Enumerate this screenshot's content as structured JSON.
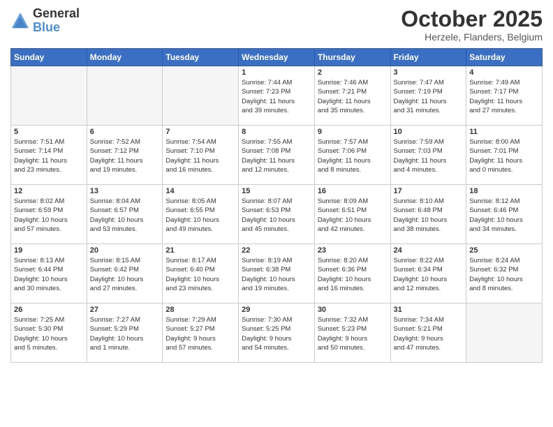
{
  "header": {
    "logo": {
      "line1": "General",
      "line2": "Blue"
    },
    "month": "October 2025",
    "location": "Herzele, Flanders, Belgium"
  },
  "weekdays": [
    "Sunday",
    "Monday",
    "Tuesday",
    "Wednesday",
    "Thursday",
    "Friday",
    "Saturday"
  ],
  "weeks": [
    [
      {
        "day": "",
        "info": "",
        "empty": true
      },
      {
        "day": "",
        "info": "",
        "empty": true
      },
      {
        "day": "",
        "info": "",
        "empty": true
      },
      {
        "day": "1",
        "info": "Sunrise: 7:44 AM\nSunset: 7:23 PM\nDaylight: 11 hours\nand 39 minutes."
      },
      {
        "day": "2",
        "info": "Sunrise: 7:46 AM\nSunset: 7:21 PM\nDaylight: 11 hours\nand 35 minutes."
      },
      {
        "day": "3",
        "info": "Sunrise: 7:47 AM\nSunset: 7:19 PM\nDaylight: 11 hours\nand 31 minutes."
      },
      {
        "day": "4",
        "info": "Sunrise: 7:49 AM\nSunset: 7:17 PM\nDaylight: 11 hours\nand 27 minutes."
      }
    ],
    [
      {
        "day": "5",
        "info": "Sunrise: 7:51 AM\nSunset: 7:14 PM\nDaylight: 11 hours\nand 23 minutes."
      },
      {
        "day": "6",
        "info": "Sunrise: 7:52 AM\nSunset: 7:12 PM\nDaylight: 11 hours\nand 19 minutes."
      },
      {
        "day": "7",
        "info": "Sunrise: 7:54 AM\nSunset: 7:10 PM\nDaylight: 11 hours\nand 16 minutes."
      },
      {
        "day": "8",
        "info": "Sunrise: 7:55 AM\nSunset: 7:08 PM\nDaylight: 11 hours\nand 12 minutes."
      },
      {
        "day": "9",
        "info": "Sunrise: 7:57 AM\nSunset: 7:06 PM\nDaylight: 11 hours\nand 8 minutes."
      },
      {
        "day": "10",
        "info": "Sunrise: 7:59 AM\nSunset: 7:03 PM\nDaylight: 11 hours\nand 4 minutes."
      },
      {
        "day": "11",
        "info": "Sunrise: 8:00 AM\nSunset: 7:01 PM\nDaylight: 11 hours\nand 0 minutes."
      }
    ],
    [
      {
        "day": "12",
        "info": "Sunrise: 8:02 AM\nSunset: 6:59 PM\nDaylight: 10 hours\nand 57 minutes."
      },
      {
        "day": "13",
        "info": "Sunrise: 8:04 AM\nSunset: 6:57 PM\nDaylight: 10 hours\nand 53 minutes."
      },
      {
        "day": "14",
        "info": "Sunrise: 8:05 AM\nSunset: 6:55 PM\nDaylight: 10 hours\nand 49 minutes."
      },
      {
        "day": "15",
        "info": "Sunrise: 8:07 AM\nSunset: 6:53 PM\nDaylight: 10 hours\nand 45 minutes."
      },
      {
        "day": "16",
        "info": "Sunrise: 8:09 AM\nSunset: 6:51 PM\nDaylight: 10 hours\nand 42 minutes."
      },
      {
        "day": "17",
        "info": "Sunrise: 8:10 AM\nSunset: 6:48 PM\nDaylight: 10 hours\nand 38 minutes."
      },
      {
        "day": "18",
        "info": "Sunrise: 8:12 AM\nSunset: 6:46 PM\nDaylight: 10 hours\nand 34 minutes."
      }
    ],
    [
      {
        "day": "19",
        "info": "Sunrise: 8:13 AM\nSunset: 6:44 PM\nDaylight: 10 hours\nand 30 minutes."
      },
      {
        "day": "20",
        "info": "Sunrise: 8:15 AM\nSunset: 6:42 PM\nDaylight: 10 hours\nand 27 minutes."
      },
      {
        "day": "21",
        "info": "Sunrise: 8:17 AM\nSunset: 6:40 PM\nDaylight: 10 hours\nand 23 minutes."
      },
      {
        "day": "22",
        "info": "Sunrise: 8:19 AM\nSunset: 6:38 PM\nDaylight: 10 hours\nand 19 minutes."
      },
      {
        "day": "23",
        "info": "Sunrise: 8:20 AM\nSunset: 6:36 PM\nDaylight: 10 hours\nand 16 minutes."
      },
      {
        "day": "24",
        "info": "Sunrise: 8:22 AM\nSunset: 6:34 PM\nDaylight: 10 hours\nand 12 minutes."
      },
      {
        "day": "25",
        "info": "Sunrise: 8:24 AM\nSunset: 6:32 PM\nDaylight: 10 hours\nand 8 minutes."
      }
    ],
    [
      {
        "day": "26",
        "info": "Sunrise: 7:25 AM\nSunset: 5:30 PM\nDaylight: 10 hours\nand 5 minutes."
      },
      {
        "day": "27",
        "info": "Sunrise: 7:27 AM\nSunset: 5:29 PM\nDaylight: 10 hours\nand 1 minute."
      },
      {
        "day": "28",
        "info": "Sunrise: 7:29 AM\nSunset: 5:27 PM\nDaylight: 9 hours\nand 57 minutes."
      },
      {
        "day": "29",
        "info": "Sunrise: 7:30 AM\nSunset: 5:25 PM\nDaylight: 9 hours\nand 54 minutes."
      },
      {
        "day": "30",
        "info": "Sunrise: 7:32 AM\nSunset: 5:23 PM\nDaylight: 9 hours\nand 50 minutes."
      },
      {
        "day": "31",
        "info": "Sunrise: 7:34 AM\nSunset: 5:21 PM\nDaylight: 9 hours\nand 47 minutes."
      },
      {
        "day": "",
        "info": "",
        "empty": true,
        "shaded": true
      }
    ]
  ]
}
